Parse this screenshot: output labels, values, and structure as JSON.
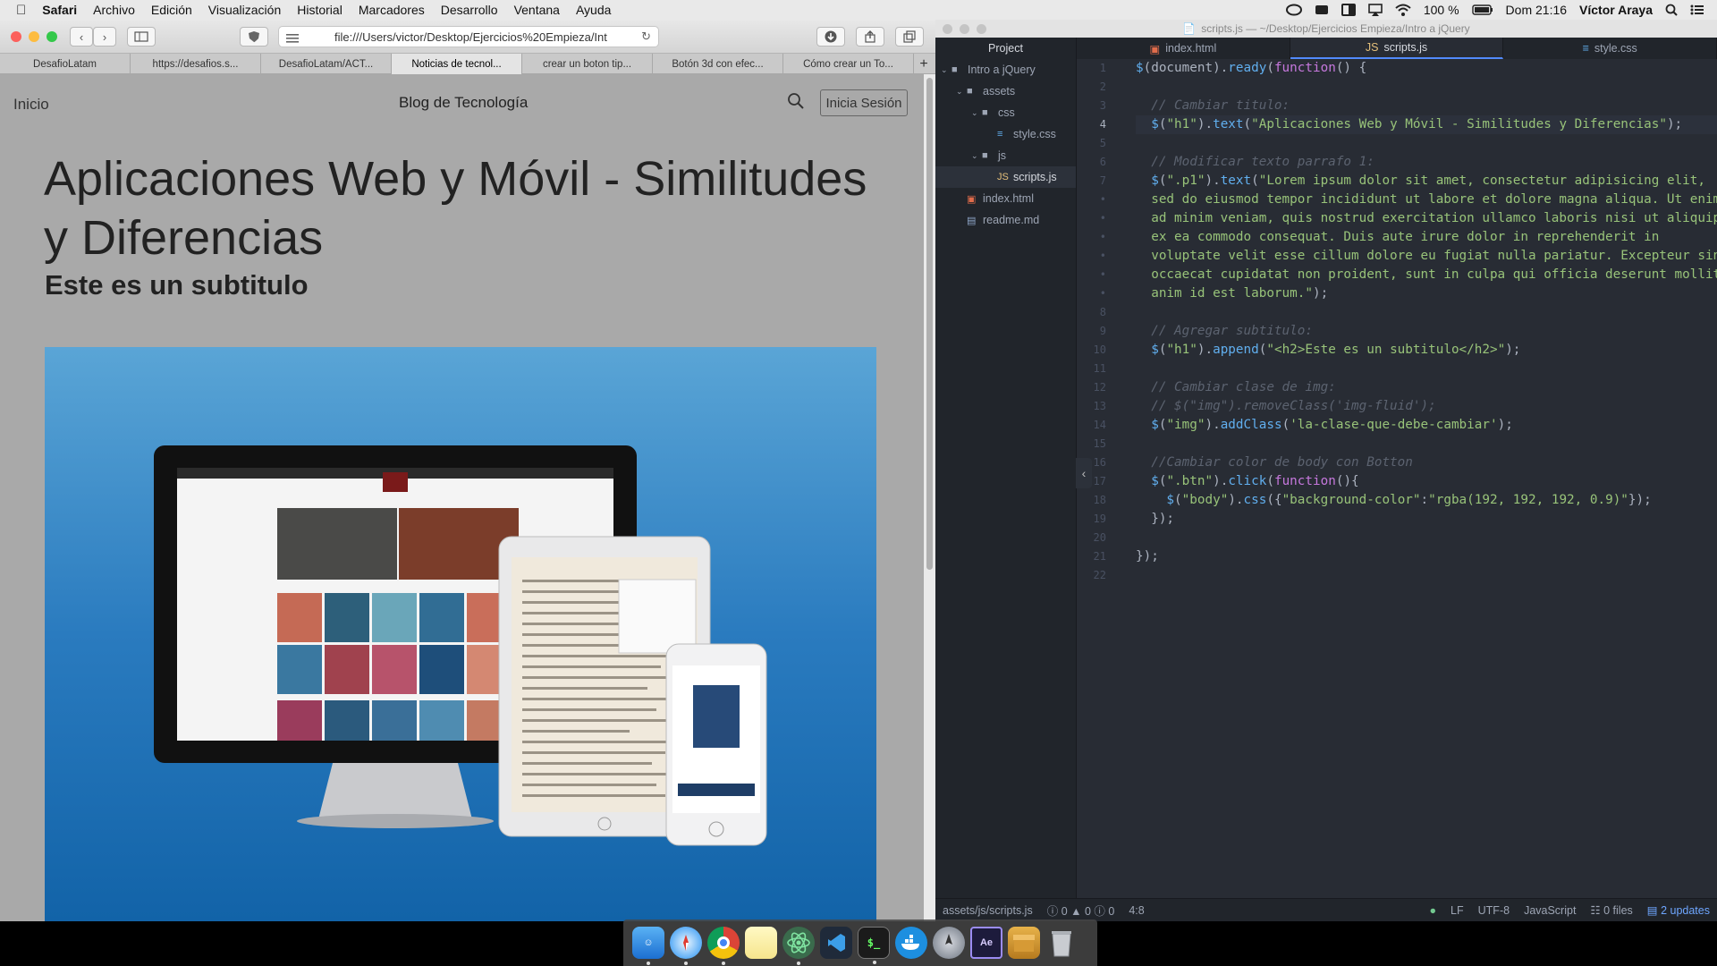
{
  "menubar": {
    "app": "Safari",
    "items": [
      "Archivo",
      "Edición",
      "Visualización",
      "Historial",
      "Marcadores",
      "Desarrollo",
      "Ventana",
      "Ayuda"
    ],
    "battery": "100 %",
    "clock": "Dom 21:16",
    "user": "Víctor Araya"
  },
  "safari": {
    "address": "file:///Users/victor/Desktop/Ejercicios%20Empieza/Int",
    "tabs": [
      "DesafioLatam",
      "https://desafios.s...",
      "DesafioLatam/ACT...",
      "Noticias de tecnol...",
      "crear un boton tip...",
      "Botón 3d con efec...",
      "Cómo crear un To..."
    ],
    "active_tab_index": 3,
    "page": {
      "nav_home": "Inicio",
      "nav_brand": "Blog de Tecnología",
      "login_button": "Inicia Sesión",
      "title": "Aplicaciones Web y Móvil - Similitudes y Diferencias",
      "subtitle": "Este es un subtitulo"
    }
  },
  "atom": {
    "window_title": "scripts.js — ~/Desktop/Ejercicios Empieza/Intro a jQuery",
    "project_header": "Project",
    "tabs": [
      "index.html",
      "scripts.js",
      "style.css"
    ],
    "active_tab_index": 1,
    "tree": [
      {
        "label": "Intro a jQuery",
        "depth": 0,
        "kind": "folder"
      },
      {
        "label": "assets",
        "depth": 1,
        "kind": "folder"
      },
      {
        "label": "css",
        "depth": 2,
        "kind": "folder"
      },
      {
        "label": "style.css",
        "depth": 3,
        "kind": "css"
      },
      {
        "label": "js",
        "depth": 2,
        "kind": "folder"
      },
      {
        "label": "scripts.js",
        "depth": 3,
        "kind": "js",
        "selected": true
      },
      {
        "label": "index.html",
        "depth": 1,
        "kind": "html"
      },
      {
        "label": "readme.md",
        "depth": 1,
        "kind": "md"
      }
    ],
    "gutter": [
      "1",
      "2",
      "3",
      "4",
      "5",
      "6",
      "7",
      "•",
      "•",
      "•",
      "•",
      "•",
      "•",
      "8",
      "9",
      "10",
      "11",
      "12",
      "13",
      "14",
      "15",
      "16",
      "17",
      "18",
      "19",
      "20",
      "21",
      "22"
    ],
    "code": [
      [
        [
          "$",
          "fn"
        ],
        [
          "(document).",
          "pn"
        ],
        [
          "ready",
          "fn"
        ],
        [
          "(",
          "pn"
        ],
        [
          "function",
          "kw"
        ],
        [
          "() {",
          "pn"
        ]
      ],
      [],
      [
        [
          "  // Cambiar titulo:",
          "cm"
        ]
      ],
      [
        [
          "  $",
          "fn"
        ],
        [
          "(",
          "pn"
        ],
        [
          "\"h1\"",
          "st"
        ],
        [
          ").",
          "pn"
        ],
        [
          "text",
          "fn"
        ],
        [
          "(",
          "pn"
        ],
        [
          "\"Aplicaciones Web y Móvil - Similitudes y Diferencias\"",
          "st"
        ],
        [
          ");",
          "pn"
        ]
      ],
      [],
      [
        [
          "  // Modificar texto parrafo 1:",
          "cm"
        ]
      ],
      [
        [
          "  $",
          "fn"
        ],
        [
          "(",
          "pn"
        ],
        [
          "\".p1\"",
          "st"
        ],
        [
          ").",
          "pn"
        ],
        [
          "text",
          "fn"
        ],
        [
          "(",
          "pn"
        ],
        [
          "\"Lorem ipsum dolor sit amet, consectetur adipisicing elit,",
          "st"
        ]
      ],
      [
        [
          "  sed do eiusmod tempor incididunt ut labore et dolore magna aliqua. Ut enim",
          "st"
        ]
      ],
      [
        [
          "  ad minim veniam, quis nostrud exercitation ullamco laboris nisi ut aliquip",
          "st"
        ]
      ],
      [
        [
          "  ex ea commodo consequat. Duis aute irure dolor in reprehenderit in",
          "st"
        ]
      ],
      [
        [
          "  voluptate velit esse cillum dolore eu fugiat nulla pariatur. Excepteur sint",
          "st"
        ]
      ],
      [
        [
          "  occaecat cupidatat non proident, sunt in culpa qui officia deserunt mollit",
          "st"
        ]
      ],
      [
        [
          "  anim id est laborum.\"",
          "st"
        ],
        [
          ");",
          "pn"
        ]
      ],
      [],
      [
        [
          "  // Agregar subtitulo:",
          "cm"
        ]
      ],
      [
        [
          "  $",
          "fn"
        ],
        [
          "(",
          "pn"
        ],
        [
          "\"h1\"",
          "st"
        ],
        [
          ").",
          "pn"
        ],
        [
          "append",
          "fn"
        ],
        [
          "(",
          "pn"
        ],
        [
          "\"<h2>Este es un subtitulo</h2>\"",
          "st"
        ],
        [
          ");",
          "pn"
        ]
      ],
      [],
      [
        [
          "  // Cambiar clase de img:",
          "cm"
        ]
      ],
      [
        [
          "  // $(\"img\").removeClass('img-fluid');",
          "cm"
        ]
      ],
      [
        [
          "  $",
          "fn"
        ],
        [
          "(",
          "pn"
        ],
        [
          "\"img\"",
          "st"
        ],
        [
          ").",
          "pn"
        ],
        [
          "addClass",
          "fn"
        ],
        [
          "(",
          "pn"
        ],
        [
          "'la-clase-que-debe-cambiar'",
          "st"
        ],
        [
          ");",
          "pn"
        ]
      ],
      [],
      [
        [
          "  //Cambiar color de body con Botton",
          "cm"
        ]
      ],
      [
        [
          "  $",
          "fn"
        ],
        [
          "(",
          "pn"
        ],
        [
          "\".btn\"",
          "st"
        ],
        [
          ").",
          "pn"
        ],
        [
          "click",
          "fn"
        ],
        [
          "(",
          "pn"
        ],
        [
          "function",
          "kw"
        ],
        [
          "(){",
          "pn"
        ]
      ],
      [
        [
          "    $",
          "fn"
        ],
        [
          "(",
          "pn"
        ],
        [
          "\"body\"",
          "st"
        ],
        [
          ").",
          "pn"
        ],
        [
          "css",
          "fn"
        ],
        [
          "({",
          "pn"
        ],
        [
          "\"background-color\"",
          "st"
        ],
        [
          ":",
          "pn"
        ],
        [
          "\"rgba(192, 192, 192, 0.9)\"",
          "st"
        ],
        [
          "});",
          "pn"
        ]
      ],
      [
        [
          "  });",
          "pn"
        ]
      ],
      [],
      [
        [
          "});",
          "pn"
        ]
      ],
      []
    ],
    "status": {
      "path": "assets/js/scripts.js",
      "diagnostics": "0 ▲ 0 ⓘ 0",
      "cursor": "4:8",
      "eol": "LF",
      "encoding": "UTF-8",
      "grammar": "JavaScript",
      "files": "0 files",
      "updates": "2 updates"
    }
  },
  "dock": [
    "finder-icon",
    "safari-icon",
    "chrome-icon",
    "notes-icon",
    "atom-icon",
    "vscode-icon",
    "terminal-icon",
    "docker-icon",
    "launchpad-icon",
    "after-effects-icon",
    "archive-icon",
    "trash-icon"
  ],
  "colors": {
    "accent": "#528bff",
    "atom_bg": "#282c34",
    "safari_page_bg": "#a9a9a9"
  }
}
